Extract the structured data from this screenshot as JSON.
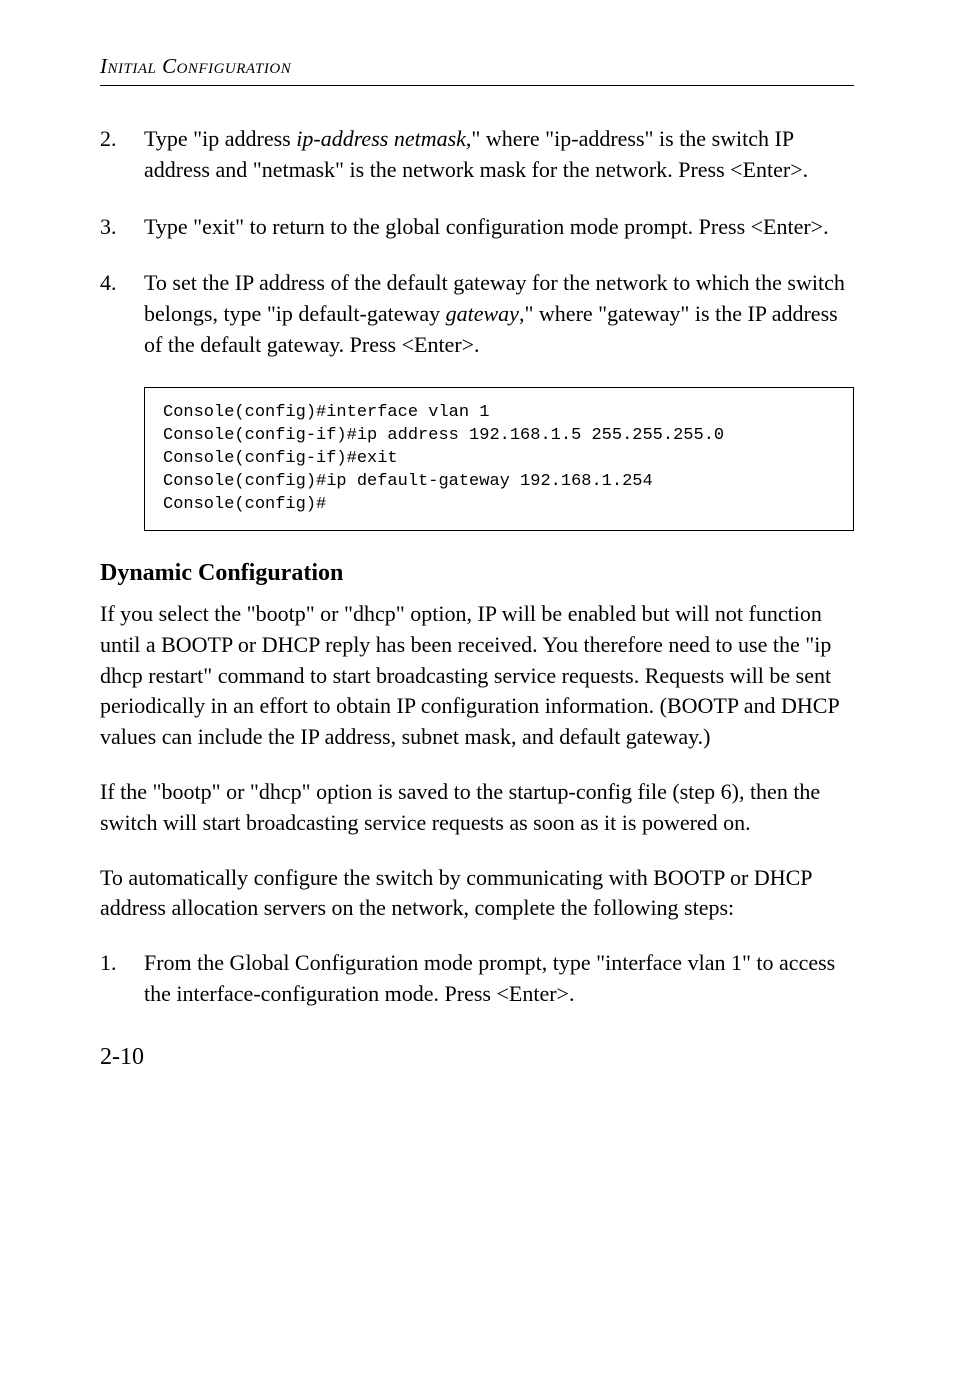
{
  "runningHead": "Initial Configuration",
  "steps_a": [
    {
      "num": "2.",
      "pre": "Type \"ip address ",
      "em": "ip-address netmask",
      "post": ",\" where \"ip-address\" is the switch IP address and \"netmask\" is the network mask for the network. Press <Enter>."
    },
    {
      "num": "3.",
      "pre": "Type \"exit\" to return to the global configuration mode prompt. Press <Enter>.",
      "em": "",
      "post": ""
    },
    {
      "num": "4.",
      "pre": "To set the IP address of the default gateway for the network to which the switch belongs, type \"ip default-gateway ",
      "em": "gateway",
      "post": ",\" where \"gateway\" is the IP address of the default gateway. Press <Enter>."
    }
  ],
  "code": "Console(config)#interface vlan 1\nConsole(config-if)#ip address 192.168.1.5 255.255.255.0\nConsole(config-if)#exit\nConsole(config)#ip default-gateway 192.168.1.254\nConsole(config)#",
  "sectionTitle": "Dynamic Configuration",
  "para1": "If you select the \"bootp\" or \"dhcp\" option, IP will be enabled but will not function until a BOOTP or DHCP reply has been received. You therefore need to use the \"ip dhcp restart\" command to start broadcasting service requests. Requests will be sent periodically in an effort to obtain IP configuration information. (BOOTP and DHCP values can include the IP address, subnet mask, and default gateway.)",
  "para2": "If the \"bootp\" or \"dhcp\" option is saved to the startup-config file (step 6), then the switch will start broadcasting service requests as soon as it is powered on.",
  "para3": "To automatically configure the switch by communicating with BOOTP or DHCP address allocation servers on the network, complete the following steps:",
  "steps_b": [
    {
      "num": "1.",
      "text": "From the Global Configuration mode prompt, type \"interface vlan 1\" to access the interface-configuration mode. Press <Enter>."
    }
  ],
  "pageNum": "2-10"
}
